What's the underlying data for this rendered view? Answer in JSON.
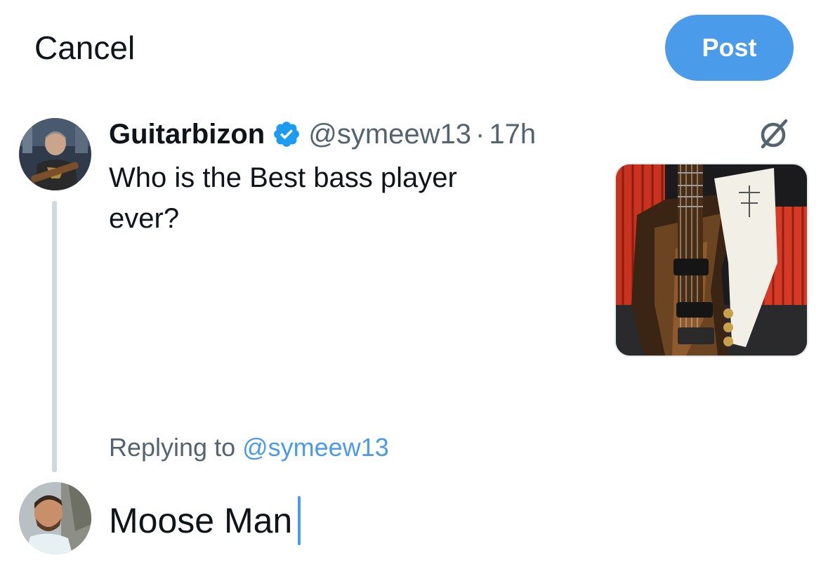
{
  "nav": {
    "cancel_label": "Cancel",
    "post_label": "Post"
  },
  "original_post": {
    "author_name": "Guitarbizon",
    "handle": "@symeew13",
    "separator": "·",
    "time": "17h",
    "text": "Who is the Best bass player ever?",
    "verified_icon": "verified-badge-icon",
    "grok_icon": "grok-icon"
  },
  "reply": {
    "replying_prefix": "Replying to",
    "replying_handle": "@symeew13",
    "draft_text": "Moose Man"
  },
  "colors": {
    "accent": "#4a9bea",
    "secondary_text": "#536471",
    "primary_text": "#0f1419",
    "thread_line": "#cfd9de"
  }
}
